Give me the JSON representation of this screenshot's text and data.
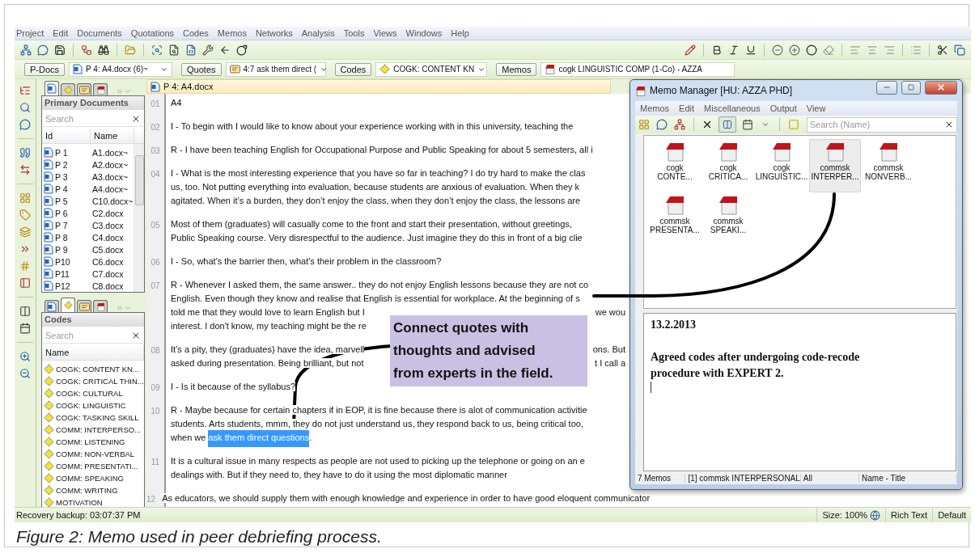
{
  "menu_bar": [
    "Project",
    "Edit",
    "Documents",
    "Quotations",
    "Codes",
    "Memos",
    "Networks",
    "Analysis",
    "Tools",
    "Views",
    "Windows",
    "Help"
  ],
  "selectors": [
    {
      "button": "P-Docs",
      "kind": "document",
      "value": "P 4: A4.docx (6)~",
      "dropdown": true
    },
    {
      "button": "Quotes",
      "kind": "quote",
      "value": "4:7 ask them direct (",
      "dropdown": true
    },
    {
      "button": "Codes",
      "kind": "code",
      "value": "COGK: CONTENT KN",
      "dropdown": true
    },
    {
      "button": "Memos",
      "kind": "memo",
      "value": "cogk LINGUISTIC COMP (1-Co) - AZZA",
      "dropdown": false
    }
  ],
  "documents_panel": {
    "tabs": [
      {
        "kind": "document",
        "selected": true
      },
      {
        "kind": "code",
        "selected": false
      },
      {
        "kind": "quote",
        "selected": false
      },
      {
        "kind": "memo",
        "selected": false
      }
    ],
    "title": "Primary Documents",
    "search": {
      "placeholder": "Search"
    },
    "columns": [
      "Id",
      "Name"
    ],
    "rows": [
      {
        "id": "P 1",
        "name": "A1.docx~"
      },
      {
        "id": "P 2",
        "name": "A2.docx~"
      },
      {
        "id": "P 3",
        "name": "A3.docx~"
      },
      {
        "id": "P 4",
        "name": "A4.docx~"
      },
      {
        "id": "P 5",
        "name": "C10.docx~"
      },
      {
        "id": "P 6",
        "name": "C2.docx"
      },
      {
        "id": "P 7",
        "name": "C3.docx"
      },
      {
        "id": "P 8",
        "name": "C4.docx"
      },
      {
        "id": "P 9",
        "name": "C5.docx"
      },
      {
        "id": "P10",
        "name": "C6.docx"
      },
      {
        "id": "P11",
        "name": "C7.docx"
      },
      {
        "id": "P12",
        "name": "C8.docx"
      }
    ]
  },
  "codes_panel": {
    "tabs": [
      {
        "kind": "document",
        "selected": false
      },
      {
        "kind": "code",
        "selected": true
      },
      {
        "kind": "quote",
        "selected": false
      },
      {
        "kind": "memo",
        "selected": false
      }
    ],
    "title": "Codes",
    "search": {
      "placeholder": "Search"
    },
    "column": "Name",
    "items": [
      "COGK: CONTENT KN...",
      "COGK: CRITICAL THIN...",
      "COGK: CULTURAL",
      "COGK: LINGUISTIC",
      "COGK: TASKING SKILL",
      "COMM: INTERPERSO...",
      "COMM: LISTENING",
      "COMM: NON-VERBAL",
      "COMM: PRESENTATI...",
      "COMM: SPEAKING",
      "COMM: WRITING",
      "MOTIVATION"
    ]
  },
  "document": {
    "title": "P 4: A4.docx",
    "paragraphs": [
      {
        "number": "01",
        "lines": [
          "A4"
        ]
      },
      {
        "number": "02",
        "lines": [
          "I - To begin with I would like to know about your experience working with in this university, teaching the"
        ]
      },
      {
        "number": "03",
        "lines": [
          "R - I have been teaching English for Occupational Purpose and Public Speaking for about 5 semesters, all i"
        ]
      },
      {
        "number": "04",
        "lines": [
          "I - What is the most interesting experience that you have so far in teaching? I do try hard to make the clas",
          "us, too. Not putting everything into evaluation, because students are anxious of evaluation. When they k",
          "agitated. When it’s a burden, they don’t enjoy the class, when they don’t enjoy the class, the lessons are"
        ]
      },
      {
        "number": "05",
        "lines": [
          "Most of them (graduates) will casually come to the front and start their presentation, without greetings,",
          "Public Speaking course. Very disrespectful to the audience. Just imagine they do this in front of a big clie"
        ]
      },
      {
        "number": "06",
        "lines": [
          "I - So, what's the barrier then, what's their problem in the classroom?"
        ]
      },
      {
        "number": "07",
        "lines": [
          "R - Whenever I asked them, the same answer.. they do not enjoy English lessons because they are not co",
          "English. Even though they know and realise that English is essential for workplace. At the beginning of s",
          [
            {
              "kind": "plain",
              "text": "told me that they would love to learn English but I"
            },
            {
              "kind": "tail",
              "text": "we wou"
            }
          ],
          "interest. I don't know, my teaching might be the re"
        ]
      },
      {
        "number": "08",
        "lines": [
          [
            {
              "kind": "plain",
              "text": "It’s a pity, they (graduates) have the idea, marvell"
            },
            {
              "kind": "tail",
              "text": "ons. But"
            }
          ],
          [
            {
              "kind": "plain",
              "text": "asked during presentation. Being brilliant, but not"
            },
            {
              "kind": "tail",
              "text": "t I call a"
            }
          ]
        ]
      },
      {
        "number": "09",
        "lines": [
          "I - Is it because of the syllabus?"
        ]
      },
      {
        "number": "10",
        "lines": [
          "R - Maybe because for certain chapters if in EOP, it is fine because there is alot of communication activitie",
          "students. Arts students, mmm, they do not just understand us, they respond back to us, being critical too,",
          [
            {
              "kind": "plain",
              "text": "when we "
            },
            {
              "kind": "quote",
              "text": "ask them direct questions"
            },
            {
              "kind": "plain",
              "text": "."
            }
          ]
        ]
      },
      {
        "number": "11",
        "lines": [
          "It is a cultural issue in many respects as people are not used to picking up the telephone or going on an e",
          "dealings with. But if they need to, they have to do it using the most diplomatic manner"
        ]
      },
      {
        "number": "12",
        "lines": [
          "As educators, we should supply them with enough knowledge and experience in order to have good eloquent communicator"
        ]
      }
    ]
  },
  "callout": {
    "lines": [
      "Connect quotes with",
      "thoughts and advised",
      "from experts in the field."
    ]
  },
  "memo_manager": {
    "title": "Memo Manager [HU: AZZA PHD]",
    "menu": [
      "Memos",
      "Edit",
      "Miscellaneous",
      "Output",
      "View"
    ],
    "search": {
      "placeholder": "Search (Name)"
    },
    "memos": [
      {
        "label": [
          "cogk",
          "CONTE..."
        ],
        "selected": false
      },
      {
        "label": [
          "cogk",
          "CRITICA..."
        ],
        "selected": false
      },
      {
        "label": [
          "cogk",
          "LINGUISTIC..."
        ],
        "selected": false
      },
      {
        "label": [
          "commsk",
          "INTERPER..."
        ],
        "selected": true
      },
      {
        "label": [
          "commsk",
          "NONVERB..."
        ],
        "selected": false
      },
      {
        "label": [
          "commsk",
          "PRESENTA..."
        ],
        "selected": false
      },
      {
        "label": [
          "commsk",
          "SPEAKI..."
        ],
        "selected": false
      }
    ],
    "editor": {
      "date": "13.2.2013",
      "body": "**Agreed codes after undergoing code-recode procedure with EXPERT 2**."
    },
    "status": [
      "7 Memos",
      "[1] commsk INTERPERSONAL",
      "All",
      "Name - Title"
    ]
  },
  "status_bar": {
    "left": "Recovery backup: 03:07:37 PM",
    "size": "Size: 100%",
    "format": "Rich Text",
    "style": "Default"
  },
  "caption": "Figure 2: Memo used in peer debriefing process."
}
